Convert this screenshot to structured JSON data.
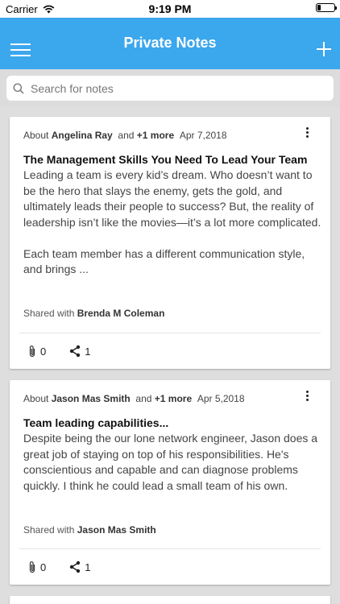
{
  "status_bar": {
    "carrier": "Carrier",
    "time": "9:19 PM",
    "battery_level": 0.2
  },
  "navbar": {
    "title": "Private Notes",
    "menu_icon": "hamburger-menu-icon",
    "add_icon": "plus-icon"
  },
  "search": {
    "placeholder": "Search for notes"
  },
  "notes": [
    {
      "about_label": "About",
      "person": "Angelina Ray",
      "and_label": "and",
      "more": "+1 more",
      "date": "Apr 7,2018",
      "title": "The Management Skills You Need To Lead Your Team",
      "body_p1": "Leading a team is every kid’s dream. Who doesn’t want to be the hero that slays the enemy, gets the gold, and ultimately leads their people to success?  But, the reality of leadership isn’t like the movies—it’s a lot more complicated.",
      "body_p2": "Each team member has a different communication style, and brings ...",
      "shared_label": "Shared with",
      "shared_with": "Brenda M  Coleman",
      "attachments": "0",
      "shares": "1"
    },
    {
      "about_label": "About",
      "person": "Jason Mas  Smith",
      "and_label": "and",
      "more": "+1 more",
      "date": "Apr 5,2018",
      "title": "Team leading capabilities...",
      "body_p1": "Despite being the our lone network engineer, Jason does a great job of staying on top of his responsibilities. He's conscientious and capable and can diagnose problems quickly. I think he could lead a small team of his own.",
      "shared_label": "Shared with",
      "shared_with": "Jason Mas  Smith",
      "attachments": "0",
      "shares": "1"
    }
  ]
}
